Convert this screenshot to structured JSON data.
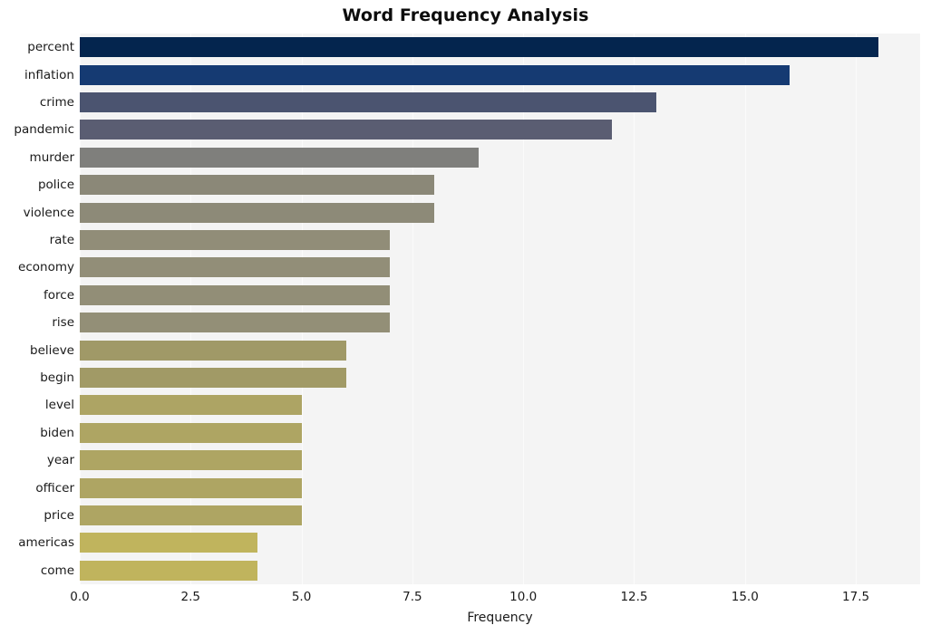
{
  "chart_data": {
    "type": "bar",
    "orientation": "horizontal",
    "title": "Word Frequency Analysis",
    "xlabel": "Frequency",
    "ylabel": "",
    "categories": [
      "percent",
      "inflation",
      "crime",
      "pandemic",
      "murder",
      "police",
      "violence",
      "rate",
      "economy",
      "force",
      "rise",
      "believe",
      "begin",
      "level",
      "biden",
      "year",
      "officer",
      "price",
      "americas",
      "come"
    ],
    "values": [
      18,
      16,
      13,
      12,
      9,
      8,
      8,
      7,
      7,
      7,
      7,
      6,
      6,
      5,
      5,
      5,
      5,
      5,
      4,
      4
    ],
    "bar_colors": [
      "#04254e",
      "#153a72",
      "#4b5470",
      "#5a5d72",
      "#7f7f7c",
      "#8b8878",
      "#8d8a78",
      "#918d78",
      "#928e78",
      "#928e77",
      "#938f77",
      "#a09967",
      "#a19a66",
      "#ada464",
      "#aea563",
      "#aea563",
      "#aea563",
      "#aea563",
      "#c0b45d",
      "#c0b45d"
    ],
    "xlim": [
      0,
      18.95
    ],
    "xticks": [
      0,
      2.5,
      5,
      7.5,
      10,
      12.5,
      15,
      17.5
    ],
    "xtick_labels": [
      "0.0",
      "2.5",
      "5.0",
      "7.5",
      "10.0",
      "12.5",
      "15.0",
      "17.5"
    ],
    "grid": true,
    "grid_axis": "x",
    "legend": "none",
    "plot_background": "#f4f4f4",
    "figure_background": "#ffffff",
    "gridline_color": "#fbfbfb"
  }
}
